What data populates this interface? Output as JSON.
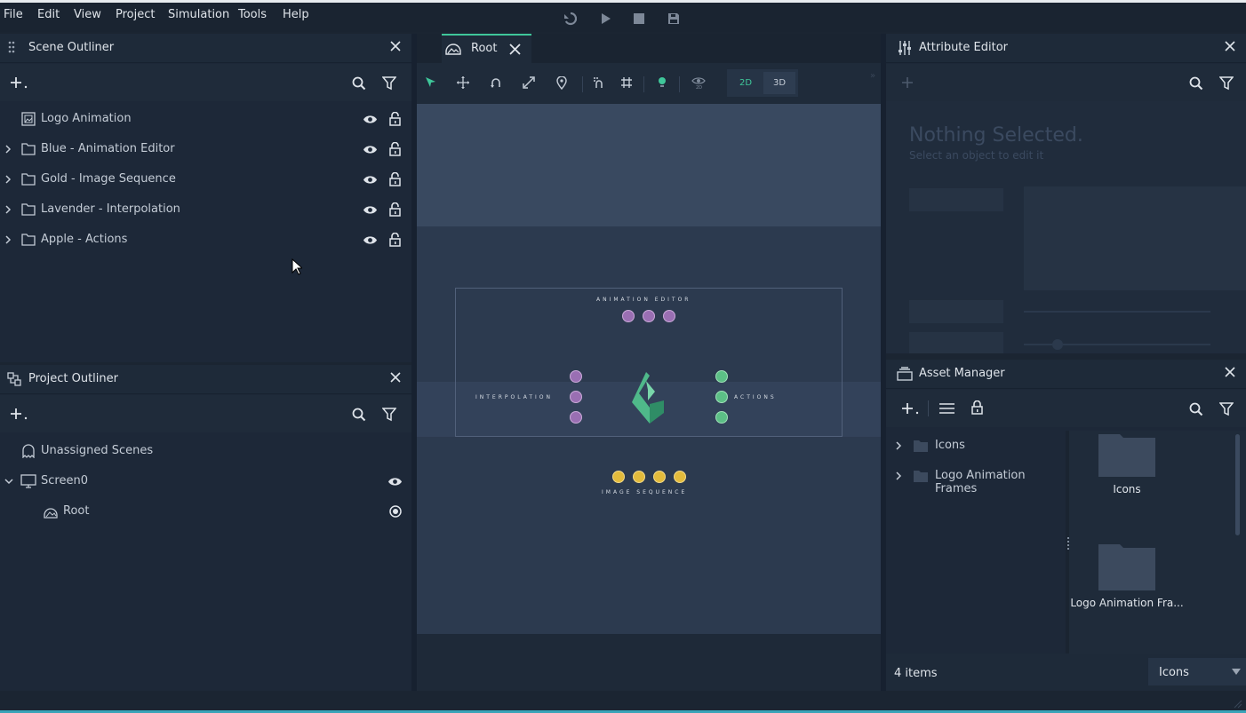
{
  "menu": [
    "File",
    "Edit",
    "View",
    "Project",
    "Simulation",
    "Tools",
    "Help"
  ],
  "scene_outliner": {
    "title": "Scene Outliner",
    "items": [
      {
        "label": "Logo Animation",
        "expandable": false
      },
      {
        "label": "Blue - Animation Editor",
        "expandable": true
      },
      {
        "label": "Gold - Image Sequence",
        "expandable": true
      },
      {
        "label": "Lavender - Interpolation",
        "expandable": true
      },
      {
        "label": "Apple - Actions",
        "expandable": true
      }
    ]
  },
  "project_outliner": {
    "title": "Project Outliner",
    "items": [
      {
        "label": "Unassigned Scenes"
      },
      {
        "label": "Screen0"
      },
      {
        "label": "Root"
      }
    ]
  },
  "viewport": {
    "tab_label": "Root",
    "mode_2d": "2D",
    "mode_3d": "3D",
    "canvas": {
      "top_label": "ANIMATION EDITOR",
      "left_label": "INTERPOLATION",
      "right_label": "ACTIONS",
      "bottom_label": "IMAGE SEQUENCE"
    }
  },
  "attribute_editor": {
    "title": "Attribute Editor",
    "empty_title": "Nothing Selected.",
    "empty_subtitle": "Select an object to edit it"
  },
  "asset_manager": {
    "title": "Asset Manager",
    "tree": [
      {
        "label": "Icons"
      },
      {
        "label": "Logo Animation Frames"
      }
    ],
    "grid": [
      {
        "label": "Icons"
      },
      {
        "label": "Logo Animation Fra..."
      }
    ],
    "count": "4 items",
    "view_select": "Icons"
  },
  "colors": {
    "accent": "#3fc79a",
    "lavender": "#9a6fb3",
    "green": "#5cbf86",
    "gold": "#e3bb3c"
  }
}
